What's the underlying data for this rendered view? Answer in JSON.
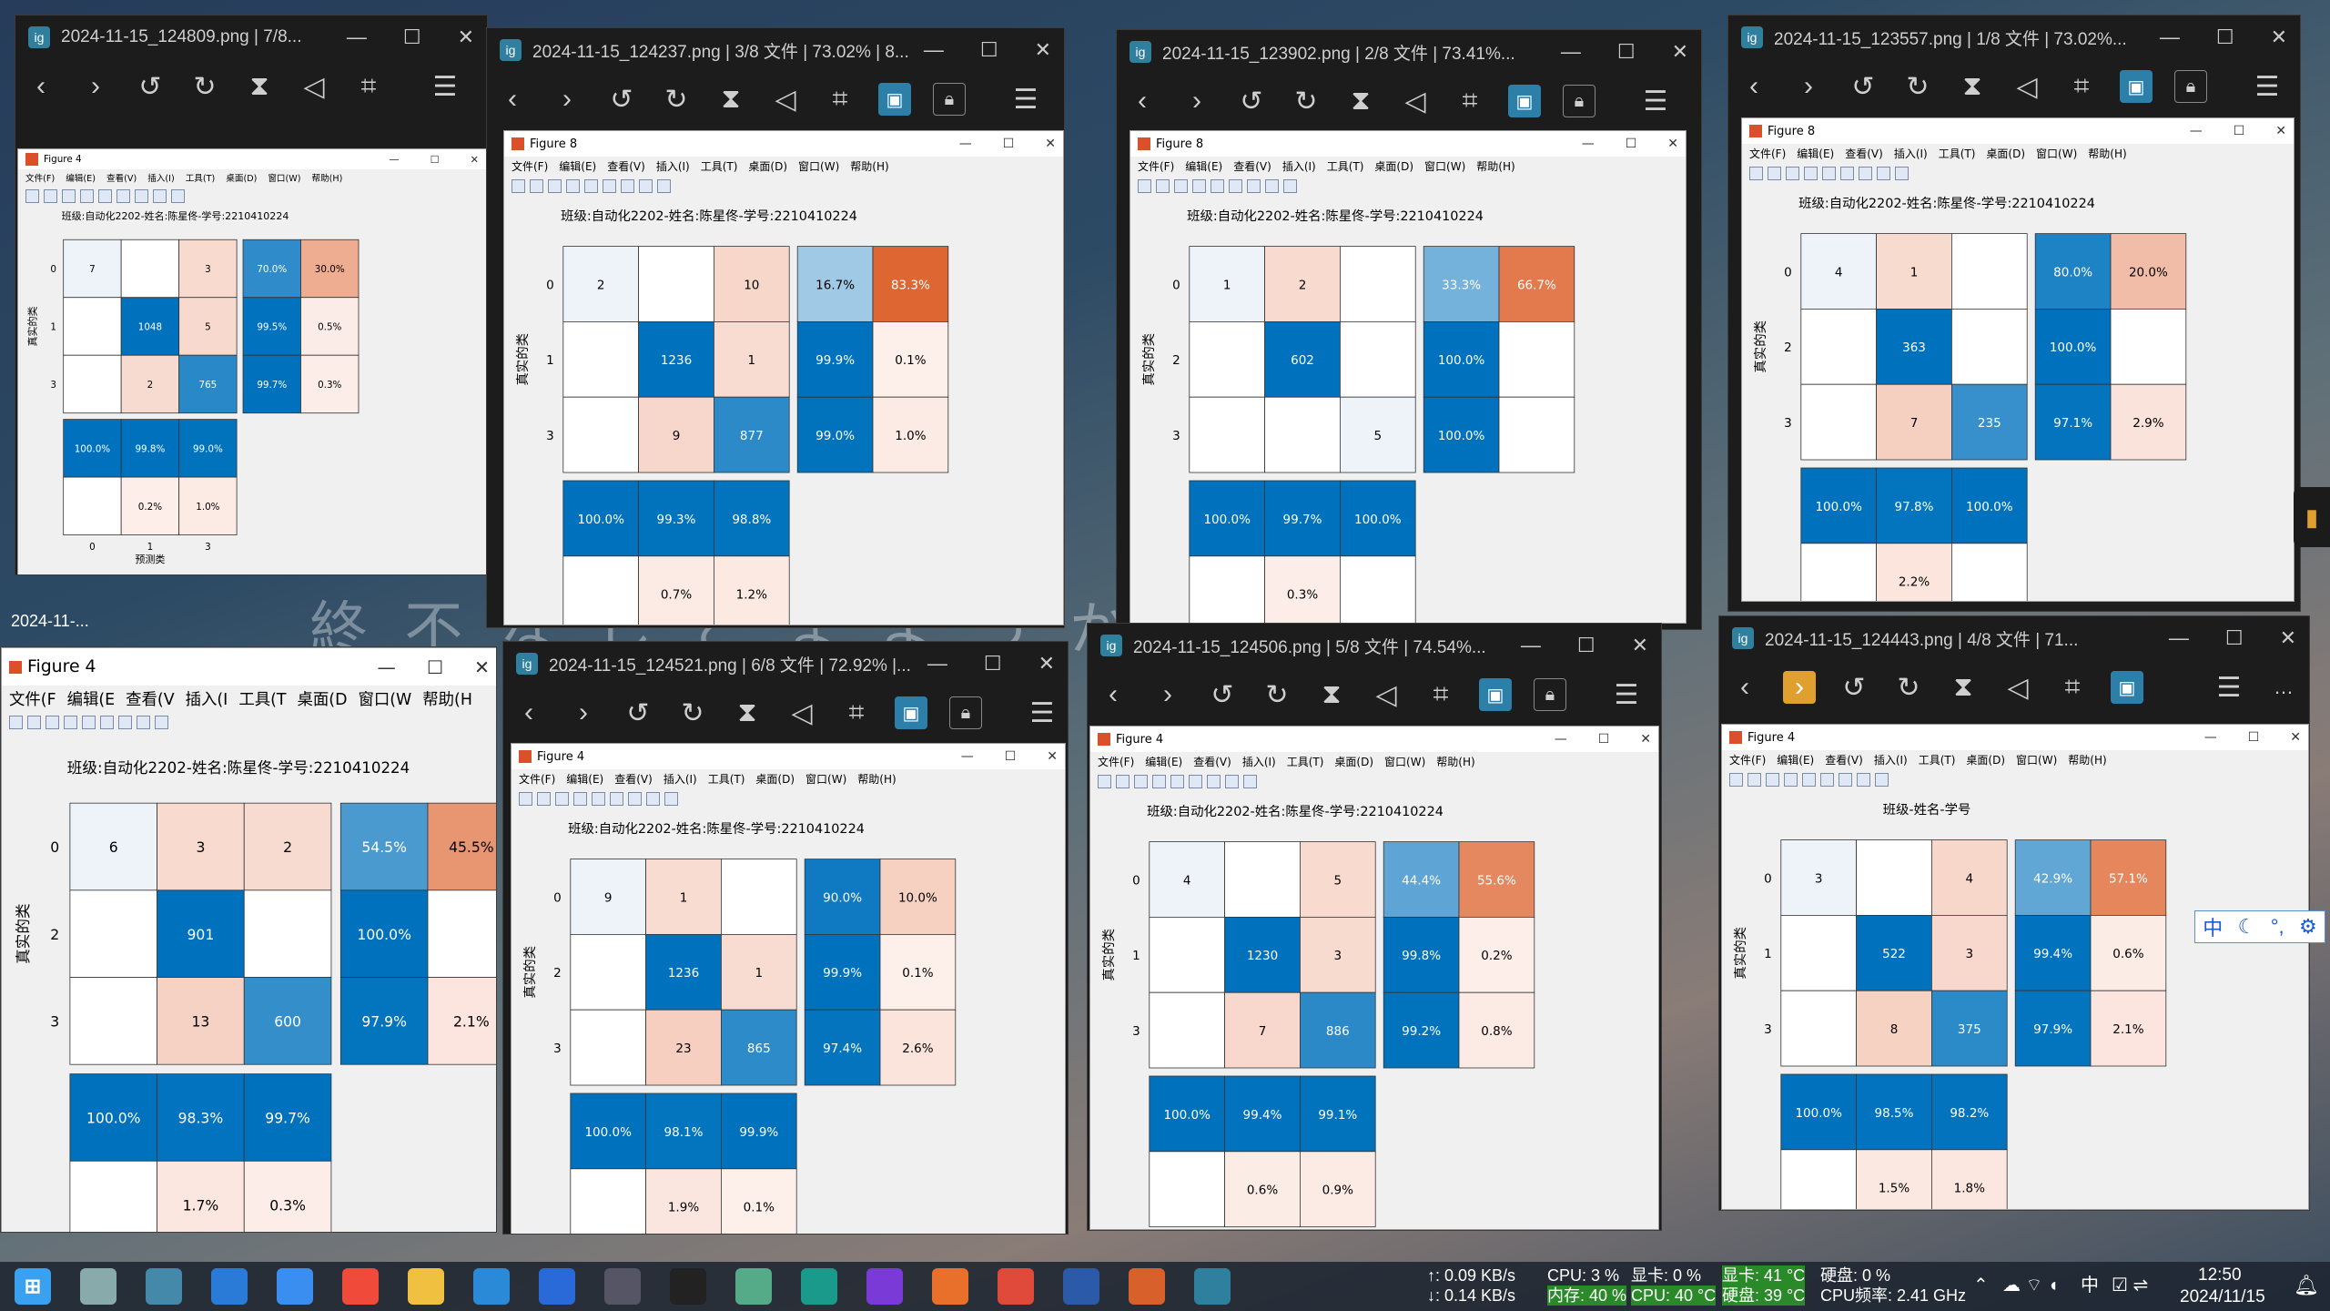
{
  "desktop": {
    "left_label": "2024-11-...",
    "watermark": "終 不 な し と ま よ う か 。 は し い"
  },
  "menu": [
    "文件(F)",
    "编辑(E)",
    "查看(V)",
    "插入(I)",
    "工具(T)",
    "桌面(D)",
    "窗口(W)",
    "帮助(H)"
  ],
  "xlabel": "预测类",
  "ylabel": "真实的类",
  "viewers": [
    {
      "title": "2024-11-15_124809.png | 7/8...",
      "fig": "Figure 4",
      "chart_title": "班级:自动化2202-姓名:陈星佟-学号:2210410224",
      "cls": [
        "0",
        "1",
        "3"
      ],
      "m": [
        [
          7,
          0,
          3
        ],
        [
          0,
          1048,
          5
        ],
        [
          0,
          2,
          765
        ]
      ],
      "rp": [
        [
          "70.0%",
          "30.0%"
        ],
        [
          "99.5%",
          "0.5%"
        ],
        [
          "99.7%",
          "0.3%"
        ]
      ],
      "cp": [
        [
          "100.0%",
          "99.8%",
          "99.0%"
        ],
        [
          "",
          "0.2%",
          "1.0%"
        ]
      ]
    },
    {
      "title": "2024-11-15_124237.png | 3/8 文件 | 73.02% | 8...",
      "fig": "Figure 8",
      "chart_title": "班级:自动化2202-姓名:陈星佟-学号:2210410224",
      "cls": [
        "0",
        "1",
        "3"
      ],
      "m": [
        [
          2,
          0,
          10
        ],
        [
          0,
          1236,
          1
        ],
        [
          0,
          9,
          877
        ]
      ],
      "rp": [
        [
          "16.7%",
          "83.3%"
        ],
        [
          "99.9%",
          "0.1%"
        ],
        [
          "99.0%",
          "1.0%"
        ]
      ],
      "cp": [
        [
          "100.0%",
          "99.3%",
          "98.8%"
        ],
        [
          "",
          "0.7%",
          "1.2%"
        ]
      ]
    },
    {
      "title": "2024-11-15_123902.png | 2/8 文件 | 73.41%...",
      "fig": "Figure 8",
      "chart_title": "班级:自动化2202-姓名:陈星佟-学号:2210410224",
      "cls": [
        "0",
        "2",
        "3"
      ],
      "m": [
        [
          1,
          2,
          0
        ],
        [
          0,
          602,
          0
        ],
        [
          0,
          0,
          5
        ]
      ],
      "rp": [
        [
          "33.3%",
          "66.7%"
        ],
        [
          "100.0%",
          ""
        ],
        [
          "100.0%",
          ""
        ]
      ],
      "cp": [
        [
          "100.0%",
          "99.7%",
          "100.0%"
        ],
        [
          "",
          "0.3%",
          ""
        ]
      ]
    },
    {
      "title": "2024-11-15_123557.png | 1/8 文件 | 73.02%...",
      "fig": "Figure 8",
      "chart_title": "班级:自动化2202-姓名:陈星佟-学号:2210410224",
      "cls": [
        "0",
        "2",
        "3"
      ],
      "m": [
        [
          4,
          1,
          0
        ],
        [
          0,
          363,
          0
        ],
        [
          0,
          7,
          235
        ]
      ],
      "rp": [
        [
          "80.0%",
          "20.0%"
        ],
        [
          "100.0%",
          ""
        ],
        [
          "97.1%",
          "2.9%"
        ]
      ],
      "cp": [
        [
          "100.0%",
          "97.8%",
          "100.0%"
        ],
        [
          "",
          "2.2%",
          ""
        ]
      ]
    },
    {
      "title": "",
      "fig": "Figure 4",
      "chart_title": "班级:自动化2202-姓名:陈星佟-学号:2210410224",
      "menu": [
        "文件(F",
        "编辑(E",
        "查看(V",
        "插入(I",
        "工具(T",
        "桌面(D",
        "窗口(W",
        "帮助(H"
      ],
      "cls": [
        "0",
        "2",
        "3"
      ],
      "m": [
        [
          6,
          3,
          2
        ],
        [
          0,
          901,
          0
        ],
        [
          0,
          13,
          600
        ]
      ],
      "rp": [
        [
          "54.5%",
          "45.5%"
        ],
        [
          "100.0%",
          ""
        ],
        [
          "97.9%",
          "2.1%"
        ]
      ],
      "cp": [
        [
          "100.0%",
          "98.3%",
          "99.7%"
        ],
        [
          "",
          "1.7%",
          "0.3%"
        ]
      ]
    },
    {
      "title": "2024-11-15_124521.png | 6/8 文件 | 72.92% |...",
      "fig": "Figure 4",
      "chart_title": "班级:自动化2202-姓名:陈星佟-学号:2210410224",
      "cls": [
        "0",
        "2",
        "3"
      ],
      "m": [
        [
          9,
          1,
          0
        ],
        [
          0,
          1236,
          1
        ],
        [
          0,
          23,
          865
        ]
      ],
      "rp": [
        [
          "90.0%",
          "10.0%"
        ],
        [
          "99.9%",
          "0.1%"
        ],
        [
          "97.4%",
          "2.6%"
        ]
      ],
      "cp": [
        [
          "100.0%",
          "98.1%",
          "99.9%"
        ],
        [
          "",
          "1.9%",
          "0.1%"
        ]
      ]
    },
    {
      "title": "2024-11-15_124506.png | 5/8 文件 | 74.54%...",
      "fig": "Figure 4",
      "chart_title": "班级:自动化2202-姓名:陈星佟-学号:2210410224",
      "cls": [
        "0",
        "1",
        "3"
      ],
      "m": [
        [
          4,
          0,
          5
        ],
        [
          0,
          1230,
          3
        ],
        [
          0,
          7,
          886
        ]
      ],
      "rp": [
        [
          "44.4%",
          "55.6%"
        ],
        [
          "99.8%",
          "0.2%"
        ],
        [
          "99.2%",
          "0.8%"
        ]
      ],
      "cp": [
        [
          "100.0%",
          "99.4%",
          "99.1%"
        ],
        [
          "",
          "0.6%",
          "0.9%"
        ]
      ]
    },
    {
      "title": "2024-11-15_124443.png | 4/8 文件 | 71...",
      "fig": "Figure 4",
      "chart_title": "班级-姓名-学号",
      "cls": [
        "0",
        "1",
        "3"
      ],
      "m": [
        [
          3,
          0,
          4
        ],
        [
          0,
          522,
          3
        ],
        [
          0,
          8,
          375
        ]
      ],
      "rp": [
        [
          "42.9%",
          "57.1%"
        ],
        [
          "99.4%",
          "0.6%"
        ],
        [
          "97.9%",
          "2.1%"
        ]
      ],
      "cp": [
        [
          "100.0%",
          "98.5%",
          "98.2%"
        ],
        [
          "",
          "1.5%",
          "1.8%"
        ]
      ]
    }
  ],
  "chart_data": {
    "type": "heatmap",
    "title": "班级:自动化2202-姓名:陈星佟-学号:2210410224",
    "xlabel": "预测类",
    "ylabel": "真实的类",
    "note": "8 confusion matrices; values listed in viewers[].m with row/column summaries"
  },
  "taskbar": {
    "apps": [
      {
        "icon": "windows-icon",
        "color": "#3aa0f0"
      },
      {
        "icon": "task-view-icon",
        "color": "#8aa"
      },
      {
        "icon": "remote-desktop-icon",
        "color": "#48a"
      },
      {
        "icon": "store-icon",
        "color": "#2a7ad8"
      },
      {
        "icon": "bird-icon",
        "color": "#3a8ef0"
      },
      {
        "icon": "diamond-icon",
        "color": "#f04a3a"
      },
      {
        "icon": "folder-icon",
        "color": "#f0c040"
      },
      {
        "icon": "vscode-icon",
        "color": "#2a8ad8"
      },
      {
        "icon": "arrow-icon",
        "color": "#2a6ad8"
      },
      {
        "icon": "devcpp-icon",
        "color": "#556"
      },
      {
        "icon": "pycharm-icon",
        "color": "#222"
      },
      {
        "icon": "monitor-icon",
        "color": "#5a8"
      },
      {
        "icon": "edge-icon",
        "color": "#1a9a8a"
      },
      {
        "icon": "podcast-icon",
        "color": "#7a3ad8"
      },
      {
        "icon": "firefox-icon",
        "color": "#e8702a"
      },
      {
        "icon": "chrome-icon",
        "color": "#e04a3a"
      },
      {
        "icon": "fortran-icon",
        "color": "#2a5aa8"
      },
      {
        "icon": "matlab-icon",
        "color": "#d8602a"
      },
      {
        "icon": "image-viewer-icon",
        "color": "#2f7f9f"
      }
    ],
    "net_up": "↑: 0.09 KB/s",
    "net_down": "↓: 0.14 KB/s",
    "cpu": "CPU: 3 %",
    "gpu": "显卡: 0 %",
    "gpu_temp": "显卡: 41 °C",
    "disk": "硬盘: 0 %",
    "mem": "内存: 40 %",
    "cpu_temp": "CPU: 40 °C",
    "disk_temp": "硬盘: 39 °C",
    "cpu_freq": "CPU频率: 2.41 GHz",
    "ime": "中",
    "time": "12:50",
    "date": "2024/11/15"
  }
}
